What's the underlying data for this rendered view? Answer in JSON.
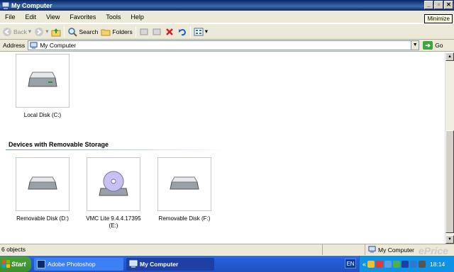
{
  "window": {
    "title": "My Computer",
    "tooltip": "Minimize"
  },
  "menu": [
    "File",
    "Edit",
    "View",
    "Favorites",
    "Tools",
    "Help"
  ],
  "toolbar": {
    "back": "Back",
    "search": "Search",
    "folders": "Folders"
  },
  "address": {
    "label": "Address",
    "value": "My Computer",
    "go": "Go"
  },
  "drives": {
    "local_c": "Local Disk (C:)",
    "section_title": "Devices with Removable Storage",
    "removable_d": "Removable Disk (D:)",
    "cd_e_line1": "VMC Lite 9.4.4.17395",
    "cd_e_line2": "(E:)",
    "removable_f": "Removable Disk (F:)"
  },
  "status": {
    "objects": "6 objects",
    "location": "My Computer"
  },
  "watermark": "ePrice",
  "taskbar": {
    "start": "Start",
    "tasks": [
      "Adobe Photoshop",
      "My Computer"
    ],
    "lang": "EN",
    "tray_chevron": "«",
    "clock": "18:14"
  },
  "colors": {
    "titlebar": "#0a246a",
    "taskbar": "#245edb",
    "tray": "#0f91e6",
    "start": "#3c8f2d"
  }
}
